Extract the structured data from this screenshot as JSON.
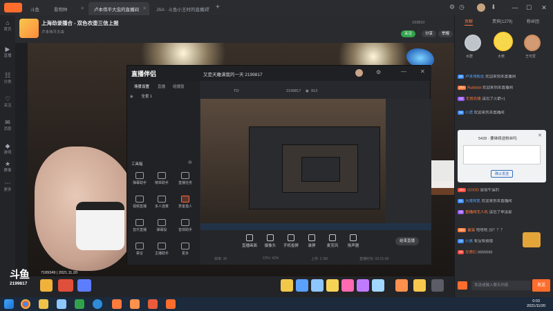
{
  "browser": {
    "tabs": [
      {
        "label": "斗鱼"
      },
      {
        "label": "看物种"
      },
      {
        "label": "卢本伟平大虫的直播间"
      },
      {
        "label": "JSA · 斗鱼小王时的直播间"
      }
    ],
    "controls": [
      "—",
      "☐",
      "✕"
    ]
  },
  "nav": {
    "items": [
      {
        "label": "首页",
        "icon": "home-icon",
        "glyph": "⌂"
      },
      {
        "label": "直播",
        "icon": "live-icon",
        "glyph": "▶"
      },
      {
        "label": "分类",
        "icon": "category-icon",
        "glyph": "☷"
      },
      {
        "label": "关注",
        "icon": "follow-icon",
        "glyph": "♡"
      },
      {
        "label": "消息",
        "icon": "message-icon",
        "glyph": "✉"
      },
      {
        "label": "游戏",
        "icon": "game-icon",
        "glyph": "◆"
      },
      {
        "label": "赛事",
        "icon": "match-icon",
        "glyph": "★"
      },
      {
        "label": "更多",
        "icon": "more-icon",
        "glyph": "⋯"
      }
    ]
  },
  "room": {
    "title": "上海劲录播合 - 双色衣壶三信上报",
    "streamer": "卢本伟平大虫",
    "follow_btn": "关注",
    "share": "分享",
    "report": "举报",
    "follower_count": "193810"
  },
  "app": {
    "logo": "直播伴侣",
    "title_line": "又是天雕满我的一天 2199817",
    "scene_tabs": [
      "场景设置",
      "直播",
      "组播窗"
    ],
    "scene_name": "全景 1",
    "tool_header": "工具箱",
    "tools": [
      {
        "label": "弹幕助手",
        "icon": "danmaku-icon"
      },
      {
        "label": "榜单助手",
        "icon": "rank-icon"
      },
      {
        "label": "直播任务",
        "icon": "task-icon"
      },
      {
        "label": "视频直播",
        "icon": "video-icon"
      },
      {
        "label": "多人连麦",
        "icon": "link-icon"
      },
      {
        "label": "赏金猎人",
        "icon": "bounty-icon",
        "accent": true
      },
      {
        "label": "音乐直播",
        "icon": "music-icon"
      },
      {
        "label": "弹幕投",
        "icon": "vote-icon"
      },
      {
        "label": "音效助手",
        "icon": "sound-icon"
      },
      {
        "label": "禁言",
        "icon": "mute-icon"
      },
      {
        "label": "主播助手",
        "icon": "assist-icon"
      },
      {
        "label": "更多",
        "icon": "more-icon"
      }
    ],
    "bottom": [
      {
        "label": "直播画面",
        "icon": "screen-icon"
      },
      {
        "label": "摄像头",
        "icon": "camera-icon"
      },
      {
        "label": "手机投屏",
        "icon": "phone-icon"
      },
      {
        "label": "录屏",
        "icon": "record-icon"
      },
      {
        "label": "麦克风",
        "icon": "mic-icon"
      },
      {
        "label": "扬声器",
        "icon": "speaker-icon"
      }
    ],
    "stop_btn": "结束直播",
    "stats": [
      "帧率: 30",
      "CPU: 42%",
      "上传: 2.3M",
      "直播时长: 03:21:09"
    ],
    "line2_left": "TO",
    "line2_id": "2199817",
    "line2_viewers": "913"
  },
  "stream": {
    "room_id_overlay": "2199817",
    "date_overlay": "7189349 | 2021.11.20",
    "logo": "斗鱼",
    "logo_sub": "2199817"
  },
  "chat": {
    "tabs": [
      "贡献",
      "贵宾(1279)",
      "粉丝团"
    ],
    "active_tab": 0,
    "top3": [
      {
        "name": "水群",
        "rank": "1"
      },
      {
        "name": "大佬",
        "rank": "2"
      },
      {
        "name": "王可爱",
        "rank": "3"
      }
    ],
    "messages": [
      {
        "badge": "20",
        "nick": "卢本伟粉丝",
        "text": "欢迎来到本直播间"
      },
      {
        "badge": "JSA",
        "nick": "Rubbish",
        "text": "欢迎来到本直播间"
      },
      {
        "badge": "AZ",
        "nick": "无畏先锋",
        "text": "送出了火箭×1"
      },
      {
        "badge": "16",
        "nick": "小虎",
        "text": "欢迎来到本直播间"
      },
      {
        "badge": "JSA",
        "nick": "GOOD",
        "text": "是挺牛逼的"
      },
      {
        "badge": "21",
        "nick": "大佬阿凯",
        "text": "欢迎来到本直播间"
      },
      {
        "badge": "18",
        "nick": "直播间无人机",
        "text": "送出了幸运星"
      },
      {
        "badge": "JSA",
        "nick": "雷霆",
        "text": "哈哈哈 28？？？"
      },
      {
        "badge": "12",
        "nick": "小黑",
        "text": "有没有搞错"
      },
      {
        "badge": "20",
        "nick": "兄弟们",
        "text": "6666666"
      }
    ],
    "popup_title": "5428 · 要继续送粉丝吗",
    "popup_btn": "确认发送",
    "input_placeholder": "发送或输入聊天内容",
    "send_btn": "发送"
  },
  "taskbar": {
    "time": "0:03",
    "date": "2021/11/20"
  }
}
